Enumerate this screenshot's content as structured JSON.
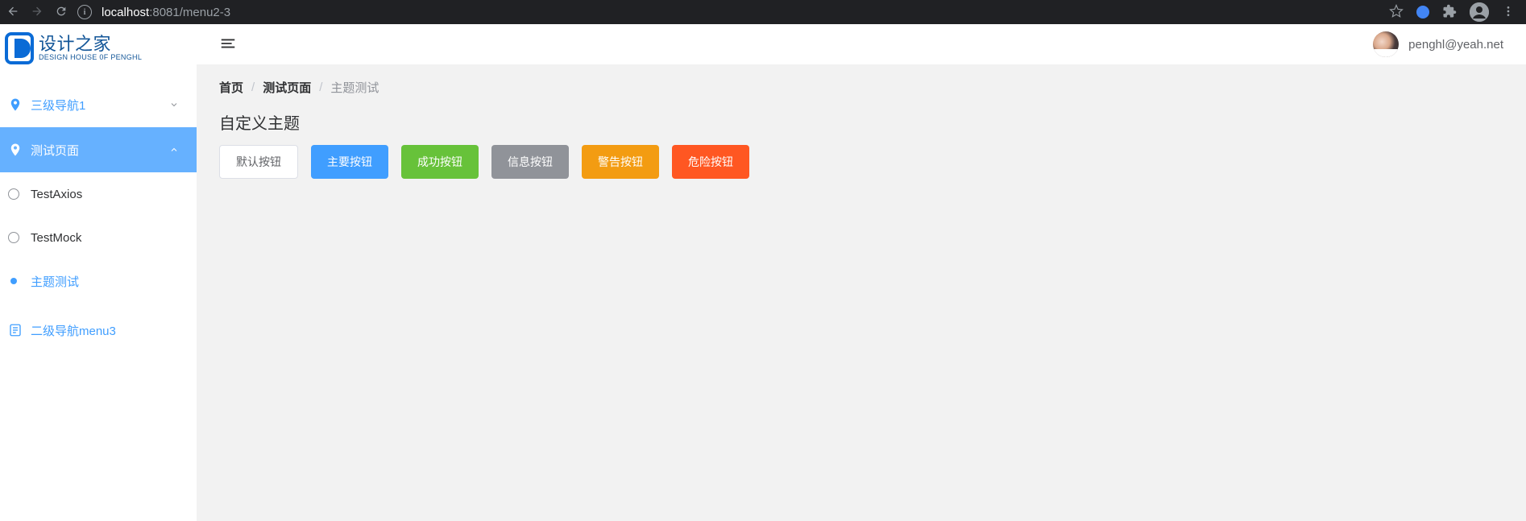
{
  "browser": {
    "url_host": "localhost",
    "url_rest": ":8081/menu2-3"
  },
  "logo": {
    "cn": "设计之家",
    "en": "DESIGN HOUSE 0F PENGHL"
  },
  "sidebar": {
    "group1": {
      "label": "三级导航1"
    },
    "group2": {
      "label": "测试页面"
    },
    "subs": [
      {
        "label": "TestAxios"
      },
      {
        "label": "TestMock"
      },
      {
        "label": "主题测试"
      }
    ],
    "group3": {
      "label": "二级导航menu3"
    }
  },
  "user": {
    "name": "penghl@yeah.net"
  },
  "breadcrumb": {
    "items": [
      {
        "label": "首页"
      },
      {
        "label": "测试页面"
      },
      {
        "label": "主题测试"
      }
    ]
  },
  "page": {
    "title": "自定义主题",
    "buttons": {
      "default": "默认按钮",
      "primary": "主要按钮",
      "success": "成功按钮",
      "info": "信息按钮",
      "warning": "警告按钮",
      "danger": "危险按钮"
    }
  },
  "colors": {
    "primary": "#409EFF",
    "success": "#67C23A",
    "info": "#909399",
    "warning": "#E6A23C",
    "danger": "#FF5722",
    "sidebar_active_bg": "#66B1FF",
    "sidebar_link": "#409EFF",
    "logo": "#135698"
  }
}
